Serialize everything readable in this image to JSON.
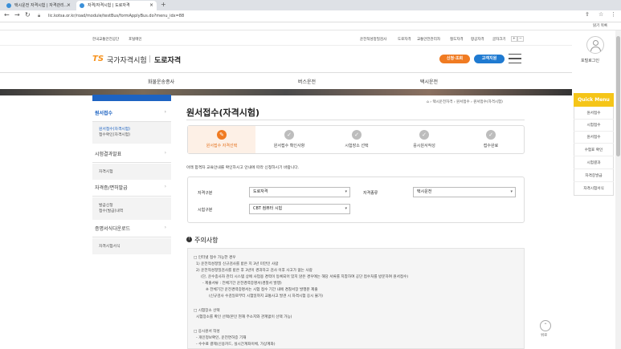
{
  "browser": {
    "tabs": [
      {
        "label": "택시운전 자격시험 | 자격관리..."
      },
      {
        "label": "자격/자격시험 | 도로자격"
      }
    ],
    "url": "lic.kotsa.or.kr/road/module/testBus/formApplyBus.do?menu_idx=88",
    "bookmark": "읽기 목록"
  },
  "header": {
    "top_left": [
      "한국교통안전공단",
      "포털메인"
    ],
    "top_right": [
      "운전적성정밀검사",
      "도로자격",
      "교통안전관리자",
      "철도자격",
      "항공자격",
      "글자크기"
    ],
    "logo_ts": "TS",
    "logo_org": "국가자격시험",
    "logo_sub": "도로자격",
    "btn_apply": "신청·조회",
    "btn_support": "고객지원",
    "login": "포털로그인"
  },
  "gnb": [
    "화물운송종사",
    "버스운전",
    "택시운전"
  ],
  "sidebar": {
    "items": [
      {
        "label": "원서접수",
        "subs": [
          "원서접수(자격시험)",
          "접수확인(자격시험)"
        ]
      },
      {
        "label": "시험결과발표",
        "subs": [
          "자격시험"
        ]
      },
      {
        "label": "자격증/면허발급",
        "subs": [
          "발급신청",
          "접수(발급)내역"
        ]
      },
      {
        "label": "증명서식다운로드",
        "subs": [
          "자격시험서식"
        ]
      }
    ]
  },
  "content": {
    "title": "원서접수(자격시험)",
    "breadcrumb": [
      "택시운전자격",
      "원서접수",
      "원서접수(자격시험)"
    ],
    "steps": [
      {
        "label": "원서접수 자격선택",
        "active": true
      },
      {
        "label": "원서접수 확인사항",
        "active": false
      },
      {
        "label": "시험장소 선택",
        "active": false
      },
      {
        "label": "응시원서작성",
        "active": false
      },
      {
        "label": "접수완료",
        "active": false
      }
    ],
    "notice": "아래 합격자 교육안내를 확인하시고 안내에 따라 신청하시기 바랍니다.",
    "form": {
      "qual_type_label": "자격구분",
      "qual_type_value": "도로자격",
      "qual_kind_label": "자격종류",
      "qual_kind_value": "택시운전",
      "exam_type_label": "시험구분",
      "exam_type_value": "CBT 컴퓨터 시험"
    },
    "caution_title": "주의사항",
    "caution_lines": [
      "□ 인터넷 접수 가능한 경우",
      "1) 운전적성정밀 신규검사를 받은 지 3년 미만인 사람",
      "2) 운전적성정밀검사를 받은 후 3년이 경과하고 검사 이후 사고가 없는 사람",
      "(단, 운수종사자 관리 시스템 상에 사업용 경력이 등록되어 있지 않은 경우에는 해당 서류를 지참하여 공단 접수처를 방문하여 원서접수)",
      "- 제출서류 : 전체기간 운전경력증명서(경찰서 발행)",
      "※ 전체기간 운전경력증명서는 시험 접수 기간 내에 경찰서장 발행분 제출",
      "(신규검사 수검일로부터 시험일까지 교통사고 발견 시 자격시험 응시 불가)",
      "",
      "□ 시험장소 선택",
      "시험장소를 확인 선택(본인 현재 주소지와 관계없이 선택 가능)",
      "",
      "□ 응시원서 작성",
      "- 개인정보확인, 운전면허증 기재",
      "- 수수료 결제(신용카드, 실시간계좌이체, 가상계좌)"
    ]
  },
  "quick_menu": {
    "title": "Quick Menu",
    "items": [
      "원서접수",
      "시험접수",
      "원서접수",
      "수험표 확인",
      "시험결과",
      "자격증발급",
      "자격시험서식"
    ]
  },
  "top_button": "위로"
}
